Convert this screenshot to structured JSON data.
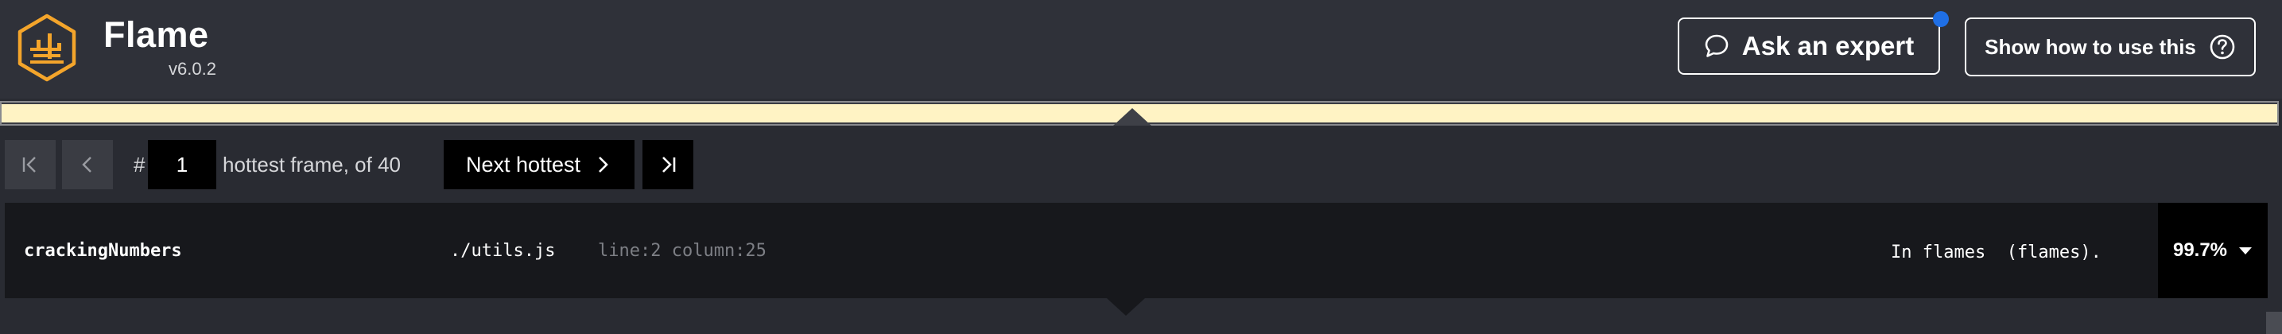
{
  "app": {
    "name": "Flame",
    "version": "v6.0.2",
    "logo_icon": "flame-hexagon-logo",
    "accent_color": "#f4a52b"
  },
  "header": {
    "ask_expert_label": "Ask an expert",
    "ask_expert_icon": "chat-bubble-icon",
    "show_how_label": "Show how to use this",
    "show_how_icon": "question-circle-icon",
    "notification_color": "#1f6fe5"
  },
  "selection_strip": {
    "color": "#fff3c4"
  },
  "navigator": {
    "first_icon": "first-frame-icon",
    "prev_icon": "chevron-left-icon",
    "hash_label": "#",
    "current_frame": "1",
    "of_text": "hottest frame, of 40",
    "next_label": "Next hottest",
    "next_icon": "chevron-right-icon",
    "last_icon": "last-frame-icon"
  },
  "frame": {
    "function_name": "crackingNumbers",
    "file": "./utils.js",
    "location": "line:2 column:25",
    "source": "In flames  (flames).",
    "percent": "99.7%",
    "dropdown_icon": "caret-down-icon"
  }
}
